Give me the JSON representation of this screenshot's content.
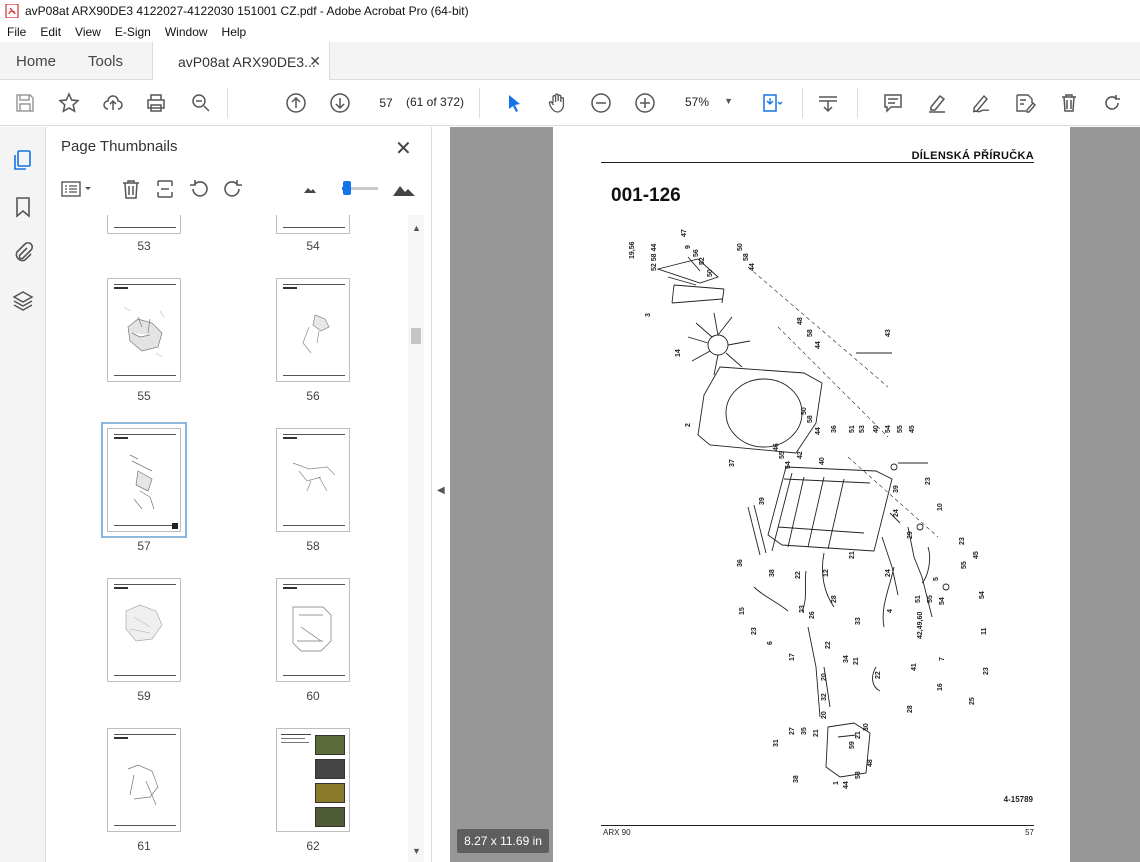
{
  "window": {
    "title": "avP08at ARX90DE3 4122027-4122030 151001 CZ.pdf - Adobe Acrobat Pro (64-bit)"
  },
  "menu": [
    "File",
    "Edit",
    "View",
    "E-Sign",
    "Window",
    "Help"
  ],
  "tabs": {
    "home": "Home",
    "tools": "Tools",
    "document": "avP08at ARX90DE3..."
  },
  "toolbar": {
    "current_page": "57",
    "page_count": "(61 of 372)",
    "zoom": "57%"
  },
  "panel": {
    "title": "Page Thumbnails"
  },
  "thumbnails": [
    {
      "label": "53"
    },
    {
      "label": "54"
    },
    {
      "label": "55"
    },
    {
      "label": "56"
    },
    {
      "label": "57"
    },
    {
      "label": "58"
    },
    {
      "label": "59"
    },
    {
      "label": "60"
    },
    {
      "label": "61"
    },
    {
      "label": "62"
    }
  ],
  "page": {
    "header": "DÍLENSKÁ PŘÍRUČKA",
    "code": "001-126",
    "reference": "4-15789",
    "footer_left": "ARX 90",
    "footer_right": "57"
  },
  "page_size_badge": "8.27 x 11.69 in",
  "colors": {
    "accent": "#1473e6",
    "doc_background": "#979797",
    "selected_thumb": "#8fb8dc"
  }
}
